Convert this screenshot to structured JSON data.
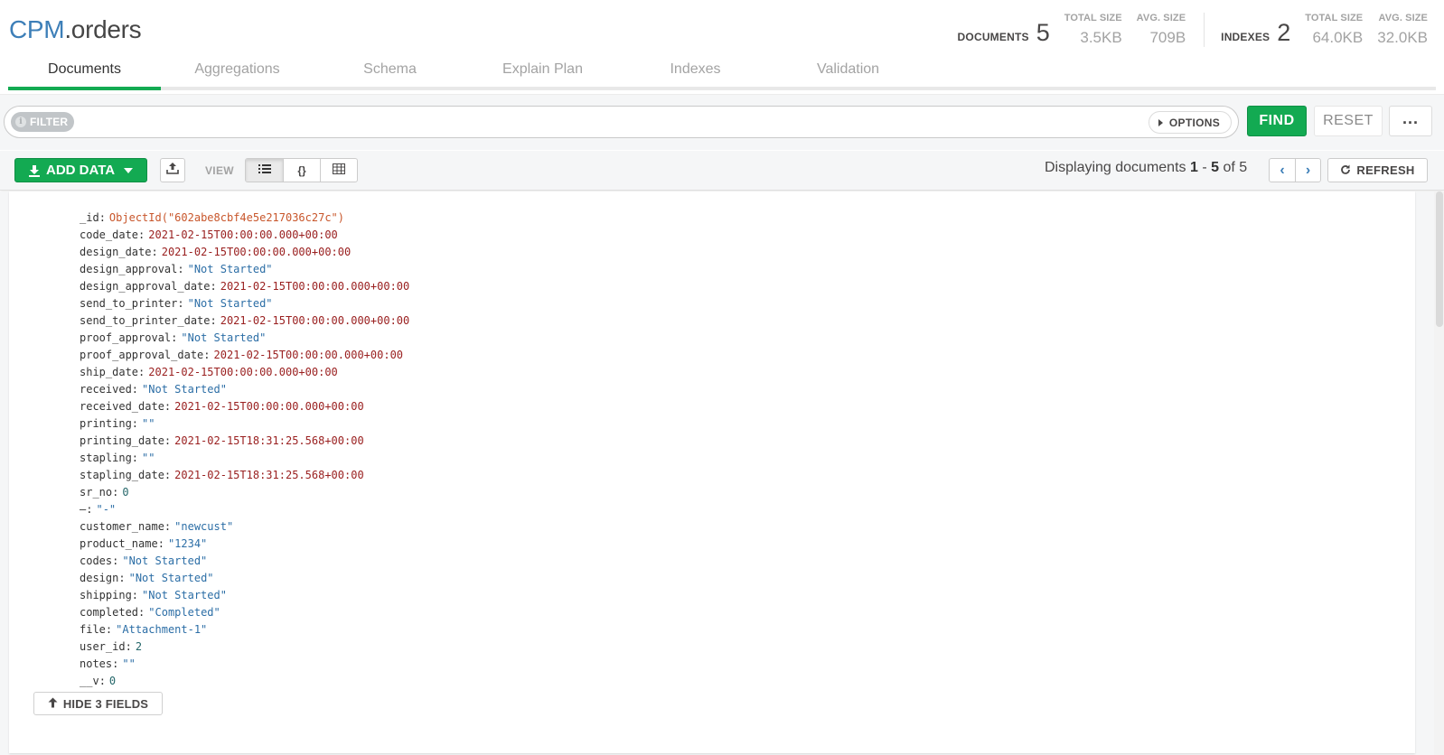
{
  "namespace": {
    "database": "CPM",
    "collection": ".orders"
  },
  "stats": {
    "documents": {
      "label": "DOCUMENTS",
      "count": "5",
      "total_size_label": "TOTAL SIZE",
      "total_size": "3.5KB",
      "avg_size_label": "AVG. SIZE",
      "avg_size": "709B"
    },
    "indexes": {
      "label": "INDEXES",
      "count": "2",
      "total_size_label": "TOTAL SIZE",
      "total_size": "64.0KB",
      "avg_size_label": "AVG. SIZE",
      "avg_size": "32.0KB"
    }
  },
  "tabs": [
    {
      "label": "Documents",
      "active": true
    },
    {
      "label": "Aggregations"
    },
    {
      "label": "Schema"
    },
    {
      "label": "Explain Plan"
    },
    {
      "label": "Indexes"
    },
    {
      "label": "Validation"
    }
  ],
  "querybar": {
    "filter_label": "FILTER",
    "filter_info_icon": "i",
    "options_label": "OPTIONS",
    "find_label": "FIND",
    "reset_label": "RESET",
    "more_label": "..."
  },
  "toolbar": {
    "add_data_label": "ADD DATA",
    "view_label": "VIEW",
    "view_modes": [
      "list-view-icon",
      "json-view-icon",
      "table-view-icon"
    ],
    "json_view_glyph": "{}",
    "paging": {
      "prefix": "Displaying documents ",
      "start": "1",
      "dash": " - ",
      "end": "5",
      "of": " of ",
      "total": "5"
    },
    "prev_glyph": "‹",
    "next_glyph": "›",
    "refresh_label": "REFRESH"
  },
  "document": {
    "fields": [
      {
        "key": "_id",
        "value": "ObjectId(\"602abe8cbf4e5e217036c27c\")",
        "type": "objectid"
      },
      {
        "key": "code_date",
        "value": "2021-02-15T00:00:00.000+00:00",
        "type": "date"
      },
      {
        "key": "design_date",
        "value": "2021-02-15T00:00:00.000+00:00",
        "type": "date"
      },
      {
        "key": "design_approval",
        "value": "\"Not Started\"",
        "type": "string"
      },
      {
        "key": "design_approval_date",
        "value": "2021-02-15T00:00:00.000+00:00",
        "type": "date"
      },
      {
        "key": "send_to_printer",
        "value": "\"Not Started\"",
        "type": "string"
      },
      {
        "key": "send_to_printer_date",
        "value": "2021-02-15T00:00:00.000+00:00",
        "type": "date"
      },
      {
        "key": "proof_approval",
        "value": "\"Not Started\"",
        "type": "string"
      },
      {
        "key": "proof_approval_date",
        "value": "2021-02-15T00:00:00.000+00:00",
        "type": "date"
      },
      {
        "key": "ship_date",
        "value": "2021-02-15T00:00:00.000+00:00",
        "type": "date"
      },
      {
        "key": "received",
        "value": "\"Not Started\"",
        "type": "string"
      },
      {
        "key": "received_date",
        "value": "2021-02-15T00:00:00.000+00:00",
        "type": "date"
      },
      {
        "key": "printing",
        "value": "\"\"",
        "type": "string"
      },
      {
        "key": "printing_date",
        "value": "2021-02-15T18:31:25.568+00:00",
        "type": "date"
      },
      {
        "key": "stapling",
        "value": "\"\"",
        "type": "string"
      },
      {
        "key": "stapling_date",
        "value": "2021-02-15T18:31:25.568+00:00",
        "type": "date"
      },
      {
        "key": "sr_no",
        "value": "0",
        "type": "number"
      },
      {
        "key": "—",
        "value": "\"-\"",
        "type": "string"
      },
      {
        "key": "customer_name",
        "value": "\"newcust\"",
        "type": "string"
      },
      {
        "key": "product_name",
        "value": "\"1234\"",
        "type": "string"
      },
      {
        "key": "codes",
        "value": "\"Not Started\"",
        "type": "string"
      },
      {
        "key": "design",
        "value": "\"Not Started\"",
        "type": "string"
      },
      {
        "key": "shipping",
        "value": "\"Not Started\"",
        "type": "string"
      },
      {
        "key": "completed",
        "value": "\"Completed\"",
        "type": "string"
      },
      {
        "key": "file",
        "value": "\"Attachment-1\"",
        "type": "string"
      },
      {
        "key": "user_id",
        "value": "2",
        "type": "number"
      },
      {
        "key": "notes",
        "value": "\"\"",
        "type": "string"
      },
      {
        "key": "__v",
        "value": "0",
        "type": "number"
      }
    ],
    "hide_fields_label": "HIDE 3 FIELDS"
  },
  "colors": {
    "brand_green": "#13aa52",
    "link_blue": "#3d7fb8",
    "objectid": "#c8562b",
    "date": "#9a2020",
    "string": "#2c6ea6",
    "number": "#25676a"
  }
}
